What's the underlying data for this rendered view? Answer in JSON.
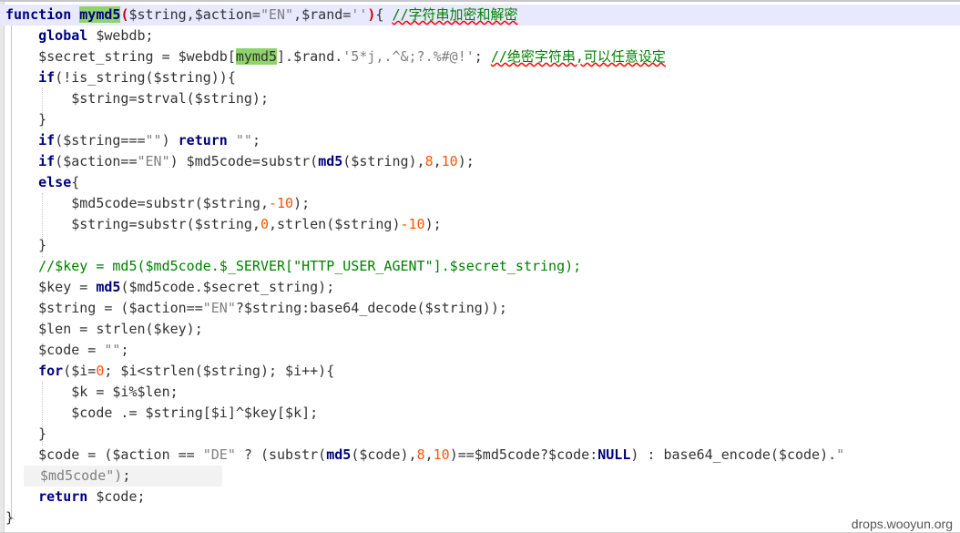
{
  "editor": {
    "lines": [
      [
        {
          "t": "function",
          "c": "kw"
        },
        {
          "t": " "
        },
        {
          "t": "mymd5",
          "c": "kw hl"
        },
        {
          "t": "(",
          "c": "br-red"
        },
        {
          "t": "$string,$action="
        },
        {
          "t": "\"EN\"",
          "c": "str"
        },
        {
          "t": ",$rand="
        },
        {
          "t": "''",
          "c": "str"
        },
        {
          "t": ")",
          "c": "br-red"
        },
        {
          "t": "{ "
        },
        {
          "t": "//字符串加密和解密",
          "c": "cmt squig"
        }
      ],
      [
        {
          "t": "    "
        },
        {
          "t": "global",
          "c": "kw"
        },
        {
          "t": " $webdb;"
        }
      ],
      [
        {
          "t": "    $secret_string = $webdb["
        },
        {
          "t": "mymd5",
          "c": "hl"
        },
        {
          "t": "].$rand."
        },
        {
          "t": "'5*j,.^&;?.%#@!'",
          "c": "str"
        },
        {
          "t": "; "
        },
        {
          "t": "//绝密字符串,可以任意设定",
          "c": "cmt squig"
        }
      ],
      [
        {
          "t": "    "
        },
        {
          "t": "if",
          "c": "kw"
        },
        {
          "t": "(!is_string($string)){"
        }
      ],
      [
        {
          "t": "        $string=strval($string);"
        }
      ],
      [
        {
          "t": "    }"
        }
      ],
      [
        {
          "t": "    "
        },
        {
          "t": "if",
          "c": "kw"
        },
        {
          "t": "($string==="
        },
        {
          "t": "\"\"",
          "c": "str"
        },
        {
          "t": ") "
        },
        {
          "t": "return",
          "c": "kw"
        },
        {
          "t": " "
        },
        {
          "t": "\"\"",
          "c": "str"
        },
        {
          "t": ";"
        }
      ],
      [
        {
          "t": "    "
        },
        {
          "t": "if",
          "c": "kw"
        },
        {
          "t": "($action=="
        },
        {
          "t": "\"EN\"",
          "c": "str"
        },
        {
          "t": ") $md5code=substr("
        },
        {
          "t": "md5",
          "c": "kw"
        },
        {
          "t": "($string),"
        },
        {
          "t": "8",
          "c": "num"
        },
        {
          "t": ","
        },
        {
          "t": "10",
          "c": "num"
        },
        {
          "t": ");"
        }
      ],
      [
        {
          "t": "    "
        },
        {
          "t": "else",
          "c": "kw"
        },
        {
          "t": "{"
        }
      ],
      [
        {
          "t": "        $md5code=substr($string,"
        },
        {
          "t": "-10",
          "c": "num"
        },
        {
          "t": ");"
        }
      ],
      [
        {
          "t": "        $string=substr($string,"
        },
        {
          "t": "0",
          "c": "num"
        },
        {
          "t": ",strlen($string)"
        },
        {
          "t": "-10",
          "c": "num"
        },
        {
          "t": ");"
        }
      ],
      [
        {
          "t": "    }"
        }
      ],
      [
        {
          "t": "    "
        },
        {
          "t": "//$key = md5($md5code.$_SERVER[\"HTTP_USER_AGENT\"].$secret_string);",
          "c": "cmt"
        }
      ],
      [
        {
          "t": "    $key = "
        },
        {
          "t": "md5",
          "c": "kw"
        },
        {
          "t": "($md5code.$secret_string);"
        }
      ],
      [
        {
          "t": "    $string = ($action=="
        },
        {
          "t": "\"EN\"",
          "c": "str"
        },
        {
          "t": "?$string:base64_decode($string));"
        }
      ],
      [
        {
          "t": "    $len = strlen($key);"
        }
      ],
      [
        {
          "t": "    $code = "
        },
        {
          "t": "\"\"",
          "c": "str"
        },
        {
          "t": ";"
        }
      ],
      [
        {
          "t": "    "
        },
        {
          "t": "for",
          "c": "kw"
        },
        {
          "t": "($i="
        },
        {
          "t": "0",
          "c": "num"
        },
        {
          "t": "; $i<strlen($string); $i++){"
        }
      ],
      [
        {
          "t": "        $k = $i%$len;"
        }
      ],
      [
        {
          "t": "        $code .= $string[$i]^$key[$k];"
        }
      ],
      [
        {
          "t": "    }"
        }
      ],
      [
        {
          "t": "    $code = ($action == "
        },
        {
          "t": "\"DE\"",
          "c": "str"
        },
        {
          "t": " ? (substr("
        },
        {
          "t": "md5",
          "c": "kw"
        },
        {
          "t": "($code),"
        },
        {
          "t": "8",
          "c": "num"
        },
        {
          "t": ","
        },
        {
          "t": "10",
          "c": "num"
        },
        {
          "t": ")==$md5code?$code:"
        },
        {
          "t": "NULL",
          "c": "kw"
        },
        {
          "t": ") : base64_encode($code)."
        },
        {
          "t": "\"",
          "c": "str"
        }
      ],
      [
        {
          "t": "$md5code\")",
          "c": "str"
        },
        {
          "t": ";"
        }
      ],
      [
        {
          "t": "    "
        },
        {
          "t": "return",
          "c": "kw"
        },
        {
          "t": " $code;"
        }
      ],
      [
        {
          "t": "}"
        }
      ]
    ]
  },
  "watermark": "drops.wooyun.org"
}
